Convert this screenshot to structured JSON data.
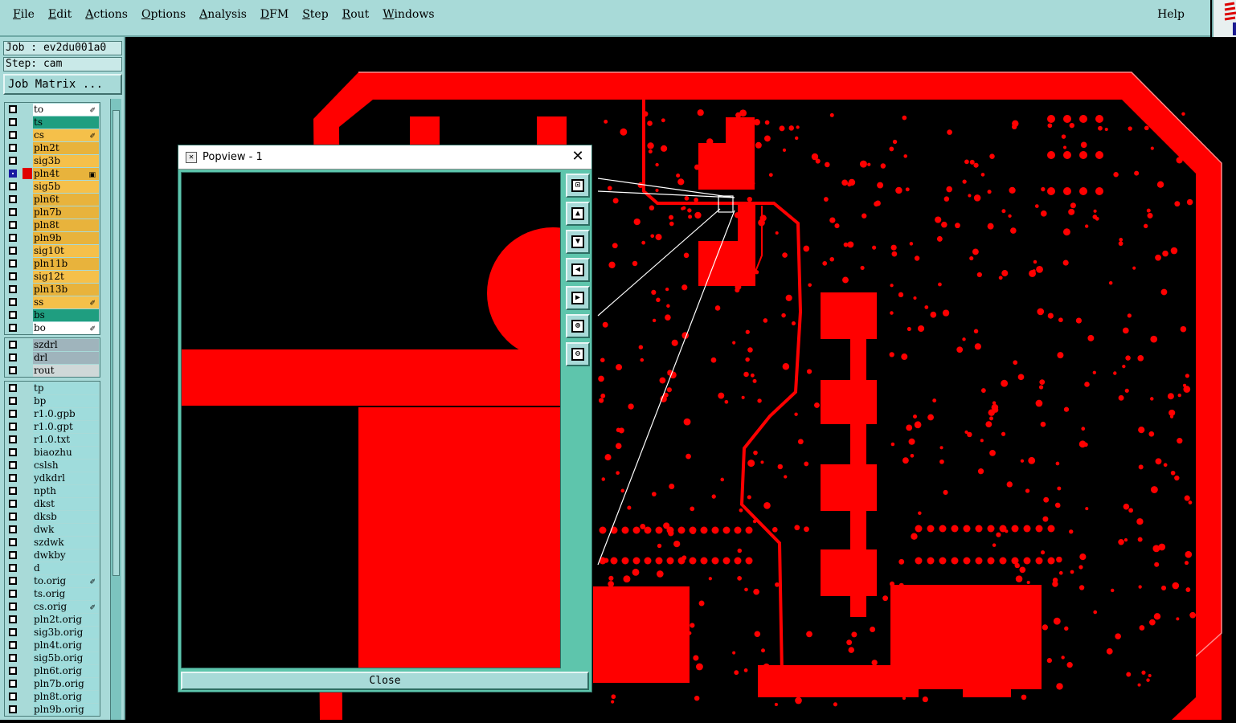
{
  "menubar": {
    "items": [
      {
        "id": "file",
        "label": "File",
        "u": "F",
        "rest": "ile"
      },
      {
        "id": "edit",
        "label": "Edit",
        "u": "E",
        "rest": "dit"
      },
      {
        "id": "actions",
        "label": "Actions",
        "u": "A",
        "rest": "ctions"
      },
      {
        "id": "options",
        "label": "Options",
        "u": "O",
        "rest": "ptions"
      },
      {
        "id": "analysis",
        "label": "Analysis",
        "u": "A",
        "rest": "nalysis"
      },
      {
        "id": "dfm",
        "label": "DFM",
        "u": "D",
        "rest": "FM"
      },
      {
        "id": "step",
        "label": "Step",
        "u": "S",
        "rest": "tep"
      },
      {
        "id": "rout",
        "label": "Rout",
        "u": "R",
        "rest": "out"
      },
      {
        "id": "windows",
        "label": "Windows",
        "u": "W",
        "rest": "indows"
      }
    ],
    "help": "Help"
  },
  "left": {
    "job": "Job : ev2du001a0",
    "step": "Step: cam",
    "job_matrix": "Job Matrix ..."
  },
  "layer_groups": [
    [
      {
        "name": "to",
        "color": "white",
        "mark": "✐"
      },
      {
        "name": "ts",
        "color": "green"
      },
      {
        "name": "cs",
        "color": "orange",
        "mark": "✐"
      },
      {
        "name": "pln2t",
        "color": "orange2"
      },
      {
        "name": "sig3b",
        "color": "orange"
      },
      {
        "name": "pln4t",
        "color": "orange2",
        "active": true,
        "swatch": "#e00000",
        "mark": "▣"
      },
      {
        "name": "sig5b",
        "color": "orange"
      },
      {
        "name": "pln6t",
        "color": "orange2"
      },
      {
        "name": "pln7b",
        "color": "orange2"
      },
      {
        "name": "pln8t",
        "color": "orange2"
      },
      {
        "name": "pln9b",
        "color": "orange2"
      },
      {
        "name": "sig10t",
        "color": "orange"
      },
      {
        "name": "pln11b",
        "color": "orange2"
      },
      {
        "name": "sig12t",
        "color": "orange"
      },
      {
        "name": "pln13b",
        "color": "orange2"
      },
      {
        "name": "ss",
        "color": "orange",
        "mark": "✐"
      },
      {
        "name": "bs",
        "color": "green"
      },
      {
        "name": "bo",
        "color": "white",
        "mark": "✐"
      }
    ],
    [
      {
        "name": "szdrl",
        "color": "gray"
      },
      {
        "name": "drl",
        "color": "gray"
      },
      {
        "name": "rout",
        "color": "lgray"
      }
    ],
    [
      {
        "name": "tp",
        "color": "cyan"
      },
      {
        "name": "bp",
        "color": "cyan"
      },
      {
        "name": "r1.0.gpb",
        "color": "cyan"
      },
      {
        "name": "r1.0.gpt",
        "color": "cyan"
      },
      {
        "name": "r1.0.txt",
        "color": "cyan"
      },
      {
        "name": "biaozhu",
        "color": "cyan"
      },
      {
        "name": "cslsh",
        "color": "cyan"
      },
      {
        "name": "ydkdrl",
        "color": "cyan"
      },
      {
        "name": "npth",
        "color": "cyan"
      },
      {
        "name": "dkst",
        "color": "cyan"
      },
      {
        "name": "dksb",
        "color": "cyan"
      },
      {
        "name": "dwk",
        "color": "cyan"
      },
      {
        "name": "szdwk",
        "color": "cyan"
      },
      {
        "name": "dwkby",
        "color": "cyan"
      },
      {
        "name": "d",
        "color": "cyan"
      },
      {
        "name": "to.orig",
        "color": "cyan",
        "mark": "✐"
      },
      {
        "name": "ts.orig",
        "color": "cyan"
      },
      {
        "name": "cs.orig",
        "color": "cyan",
        "mark": "✐"
      },
      {
        "name": "pln2t.orig",
        "color": "cyan"
      },
      {
        "name": "sig3b.orig",
        "color": "cyan"
      },
      {
        "name": "pln4t.orig",
        "color": "cyan"
      },
      {
        "name": "sig5b.orig",
        "color": "cyan"
      },
      {
        "name": "pln6t.orig",
        "color": "cyan"
      },
      {
        "name": "pln7b.orig",
        "color": "cyan"
      },
      {
        "name": "pln8t.orig",
        "color": "cyan"
      },
      {
        "name": "pln9b.orig",
        "color": "cyan"
      }
    ]
  ],
  "popview": {
    "title": "Popview - 1",
    "close_x": "✕",
    "close_label": "Close",
    "tools": [
      "zoom-fit",
      "pan-up",
      "pan-down",
      "pan-left",
      "pan-right",
      "zoom-in",
      "zoom-out"
    ]
  },
  "colors": {
    "panel": "#a8dad8",
    "feature": "#ff0000",
    "background": "#000000",
    "popview_frame": "#5ec5ac"
  }
}
